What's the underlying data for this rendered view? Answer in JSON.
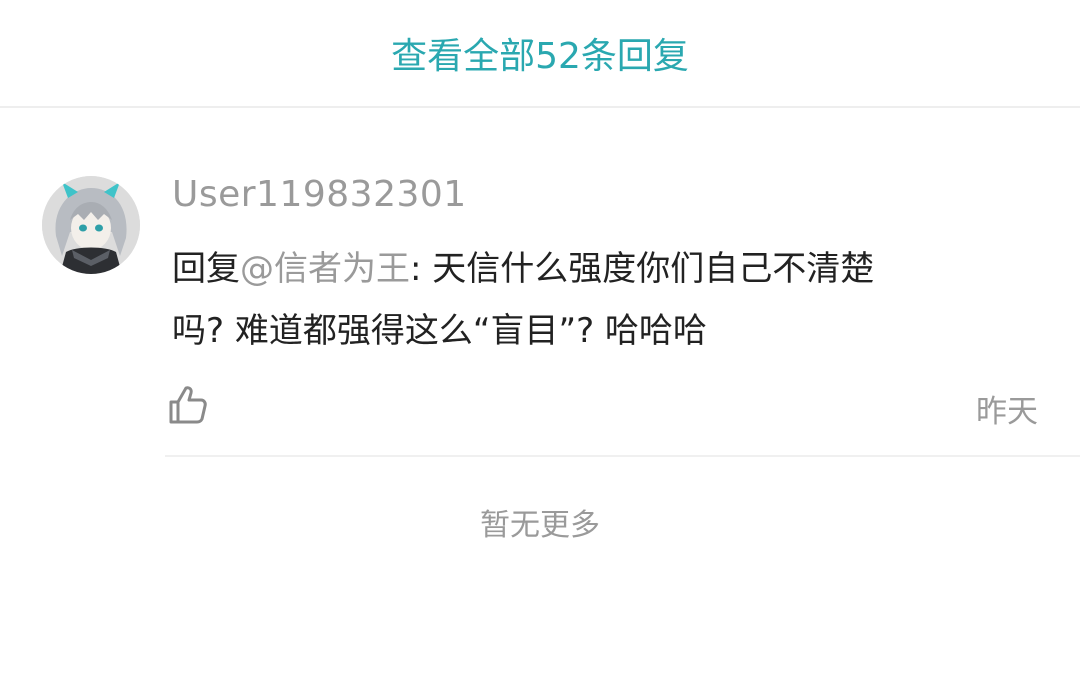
{
  "header": {
    "view_all_label": "查看全部52条回复"
  },
  "comment": {
    "username": "User119832301",
    "reply_prefix": "回复",
    "mention": "@信者为王",
    "content_line1": ": 天信什么强度你们自己不清楚",
    "content_line2": "吗? 难道都强得这么“盲目”? 哈哈哈",
    "timestamp": "昨天",
    "like_icon": "thumbs-up-icon"
  },
  "footer": {
    "no_more_label": "暂无更多"
  },
  "colors": {
    "accent": "#2aa8b0",
    "muted": "#9a9a9a",
    "text": "#222222",
    "divider": "#eeeeee"
  }
}
